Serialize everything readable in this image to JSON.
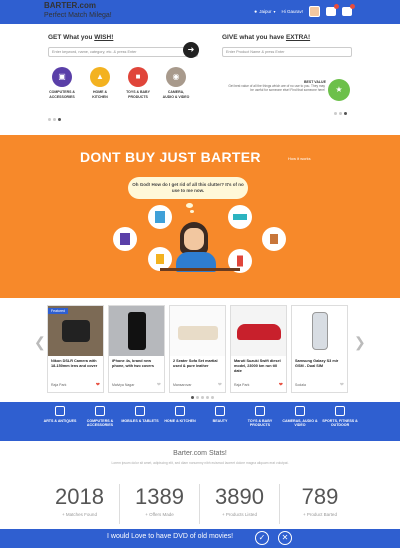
{
  "header": {
    "logo": "BARTER.com",
    "tagline": "Perfect Match Milega!",
    "location": "Jaipur",
    "greeting": "Hi Gaurav!"
  },
  "wish": {
    "title_prefix": "GET What you ",
    "title_highlight": "WISH!",
    "placeholder": "Enter keyword, name, category, etc. & press Enter"
  },
  "extra": {
    "title_prefix": "GIVE what you have ",
    "title_highlight": "EXTRA!",
    "placeholder": "Enter Product Name & press Enter",
    "best_value_label": "BEST VALUE",
    "description": "Get best value of all the things which are of no use to you. They may be useful for someone else! Find that someone here!"
  },
  "categories_top": [
    {
      "label": "COMPUTERS & ACCESSORIES",
      "color": "#5a3fa8",
      "icon": "monitor-icon"
    },
    {
      "label": "HOME & KITCHEN",
      "color": "#f3b220",
      "icon": "lamp-icon"
    },
    {
      "label": "TOYS & BABY PRODUCTS",
      "color": "#e0453a",
      "icon": "car-icon"
    },
    {
      "label": "CAMERA, AUDIO & VIDEO",
      "color": "#a89a8c",
      "icon": "camera-icon"
    }
  ],
  "banner": {
    "title": "DONT BUY JUST BARTER",
    "subtitle": "How it works",
    "thought": "Oh God! How do I get rid of all this clutter? It's of no use to me now."
  },
  "products": [
    {
      "badge": "Featured",
      "name": "Nikon DSLR Camera with 18-150mm lens and cover",
      "location": "Raja Park",
      "liked": true
    },
    {
      "name": "iPhone 4s, brand new phone, with two covers",
      "location": "Malviya Nagar",
      "liked": false
    },
    {
      "name": "2 Seater Sofa Set martial used & pure leather",
      "location": "Mansarovar",
      "liked": false
    },
    {
      "name": "Maruti Suzuki Swift diesel model, 23000 km run till date",
      "location": "Raja Park",
      "liked": true
    },
    {
      "name": "Samsung Galaxy S3 mir GSM - Dual SIM",
      "location": "Sodala",
      "liked": false
    }
  ],
  "category_bar": [
    {
      "label": "ARTS & ANTIQUES",
      "icon": "easel-icon"
    },
    {
      "label": "COMPUTERS & ACCESSORIES",
      "icon": "monitor-icon"
    },
    {
      "label": "MOBILES & TABLETS",
      "icon": "mobile-icon"
    },
    {
      "label": "HOME & KITCHEN",
      "icon": "lamp-icon"
    },
    {
      "label": "BEAUTY",
      "icon": "lipstick-icon"
    },
    {
      "label": "TOYS & BABY PRODUCTS",
      "icon": "car-icon"
    },
    {
      "label": "CAMERAS, AUDIO & VIDEO",
      "icon": "camera-icon"
    },
    {
      "label": "SPORTS, FITNESS & OUTDOOR",
      "icon": "runner-icon"
    }
  ],
  "stats": {
    "title": "Barter.com Stats!",
    "description": "Lorem ipsum dolor sit amet, adipiscing elit, sed diam nonummy nibh euismod laoreet dolore magna aliquam erat volutpat.",
    "items": [
      {
        "value": "2018",
        "caption": "+ Matches Found"
      },
      {
        "value": "1389",
        "caption": "+ Offers Made"
      },
      {
        "value": "3890",
        "caption": "+ Products Listed"
      },
      {
        "value": "789",
        "caption": "+ Product Barted"
      }
    ]
  },
  "bottom": {
    "prompt": "I would Love to have DVD of old movies!"
  },
  "colors": {
    "brand_blue": "#2f5fd0",
    "banner_orange": "#f7892a",
    "heart": "#e74c3c"
  }
}
